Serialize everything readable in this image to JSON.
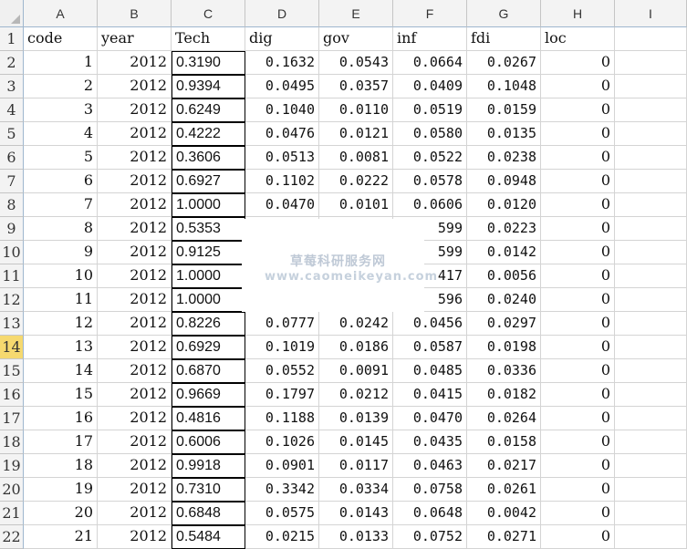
{
  "columns": [
    "A",
    "B",
    "C",
    "D",
    "E",
    "F",
    "G",
    "H",
    "I"
  ],
  "selected_row": "14",
  "rows": [
    {
      "n": "1",
      "A": "code",
      "B": "year",
      "C": "Tech",
      "D": "dig",
      "E": "gov",
      "F": "inf",
      "G": "fdi",
      "H": "loc"
    },
    {
      "n": "2",
      "A": "1",
      "B": "2012",
      "C": "0.3190",
      "D": "0.1632",
      "E": "0.0543",
      "F": "0.0664",
      "G": "0.0267",
      "H": "0"
    },
    {
      "n": "3",
      "A": "2",
      "B": "2012",
      "C": "0.9394",
      "D": "0.0495",
      "E": "0.0357",
      "F": "0.0409",
      "G": "0.1048",
      "H": "0"
    },
    {
      "n": "4",
      "A": "3",
      "B": "2012",
      "C": "0.6249",
      "D": "0.1040",
      "E": "0.0110",
      "F": "0.0519",
      "G": "0.0159",
      "H": "0"
    },
    {
      "n": "5",
      "A": "4",
      "B": "2012",
      "C": "0.4222",
      "D": "0.0476",
      "E": "0.0121",
      "F": "0.0580",
      "G": "0.0135",
      "H": "0"
    },
    {
      "n": "6",
      "A": "5",
      "B": "2012",
      "C": "0.3606",
      "D": "0.0513",
      "E": "0.0081",
      "F": "0.0522",
      "G": "0.0238",
      "H": "0"
    },
    {
      "n": "7",
      "A": "6",
      "B": "2012",
      "C": "0.6927",
      "D": "0.1102",
      "E": "0.0222",
      "F": "0.0578",
      "G": "0.0948",
      "H": "0"
    },
    {
      "n": "8",
      "A": "7",
      "B": "2012",
      "C": "1.0000",
      "D": "0.0470",
      "E": "0.0101",
      "F": "0.0606",
      "G": "0.0120",
      "H": "0"
    },
    {
      "n": "9",
      "A": "8",
      "B": "2012",
      "C": "0.5353",
      "D": "",
      "E": "",
      "F": "599",
      "G": "0.0223",
      "H": "0"
    },
    {
      "n": "10",
      "A": "9",
      "B": "2012",
      "C": "0.9125",
      "D": "",
      "E": "",
      "F": "599",
      "G": "0.0142",
      "H": "0"
    },
    {
      "n": "11",
      "A": "10",
      "B": "2012",
      "C": "1.0000",
      "D": "",
      "E": "",
      "F": "417",
      "G": "0.0056",
      "H": "0"
    },
    {
      "n": "12",
      "A": "11",
      "B": "2012",
      "C": "1.0000",
      "D": "",
      "E": "",
      "F": "596",
      "G": "0.0240",
      "H": "0"
    },
    {
      "n": "13",
      "A": "12",
      "B": "2012",
      "C": "0.8226",
      "D": "0.0777",
      "E": "0.0242",
      "F": "0.0456",
      "G": "0.0297",
      "H": "0"
    },
    {
      "n": "14",
      "A": "13",
      "B": "2012",
      "C": "0.6929",
      "D": "0.1019",
      "E": "0.0186",
      "F": "0.0587",
      "G": "0.0198",
      "H": "0"
    },
    {
      "n": "15",
      "A": "14",
      "B": "2012",
      "C": "0.6870",
      "D": "0.0552",
      "E": "0.0091",
      "F": "0.0485",
      "G": "0.0336",
      "H": "0"
    },
    {
      "n": "16",
      "A": "15",
      "B": "2012",
      "C": "0.9669",
      "D": "0.1797",
      "E": "0.0212",
      "F": "0.0415",
      "G": "0.0182",
      "H": "0"
    },
    {
      "n": "17",
      "A": "16",
      "B": "2012",
      "C": "0.4816",
      "D": "0.1188",
      "E": "0.0139",
      "F": "0.0470",
      "G": "0.0264",
      "H": "0"
    },
    {
      "n": "18",
      "A": "17",
      "B": "2012",
      "C": "0.6006",
      "D": "0.1026",
      "E": "0.0145",
      "F": "0.0435",
      "G": "0.0158",
      "H": "0"
    },
    {
      "n": "19",
      "A": "18",
      "B": "2012",
      "C": "0.9918",
      "D": "0.0901",
      "E": "0.0117",
      "F": "0.0463",
      "G": "0.0217",
      "H": "0"
    },
    {
      "n": "20",
      "A": "19",
      "B": "2012",
      "C": "0.7310",
      "D": "0.3342",
      "E": "0.0334",
      "F": "0.0758",
      "G": "0.0261",
      "H": "0"
    },
    {
      "n": "21",
      "A": "20",
      "B": "2012",
      "C": "0.6848",
      "D": "0.0575",
      "E": "0.0143",
      "F": "0.0648",
      "G": "0.0042",
      "H": "0"
    },
    {
      "n": "22",
      "A": "21",
      "B": "2012",
      "C": "0.5484",
      "D": "0.0215",
      "E": "0.0133",
      "F": "0.0752",
      "G": "0.0271",
      "H": "0"
    }
  ],
  "watermark": {
    "line1": "草莓科研服务网",
    "line2": "www.caomeikeyan.com"
  },
  "colors": {
    "header_bg": "#f3f3f3",
    "selected_row_bg": "#f6d96f",
    "grid": "#d4d4d4",
    "tech_border": "#000000"
  }
}
